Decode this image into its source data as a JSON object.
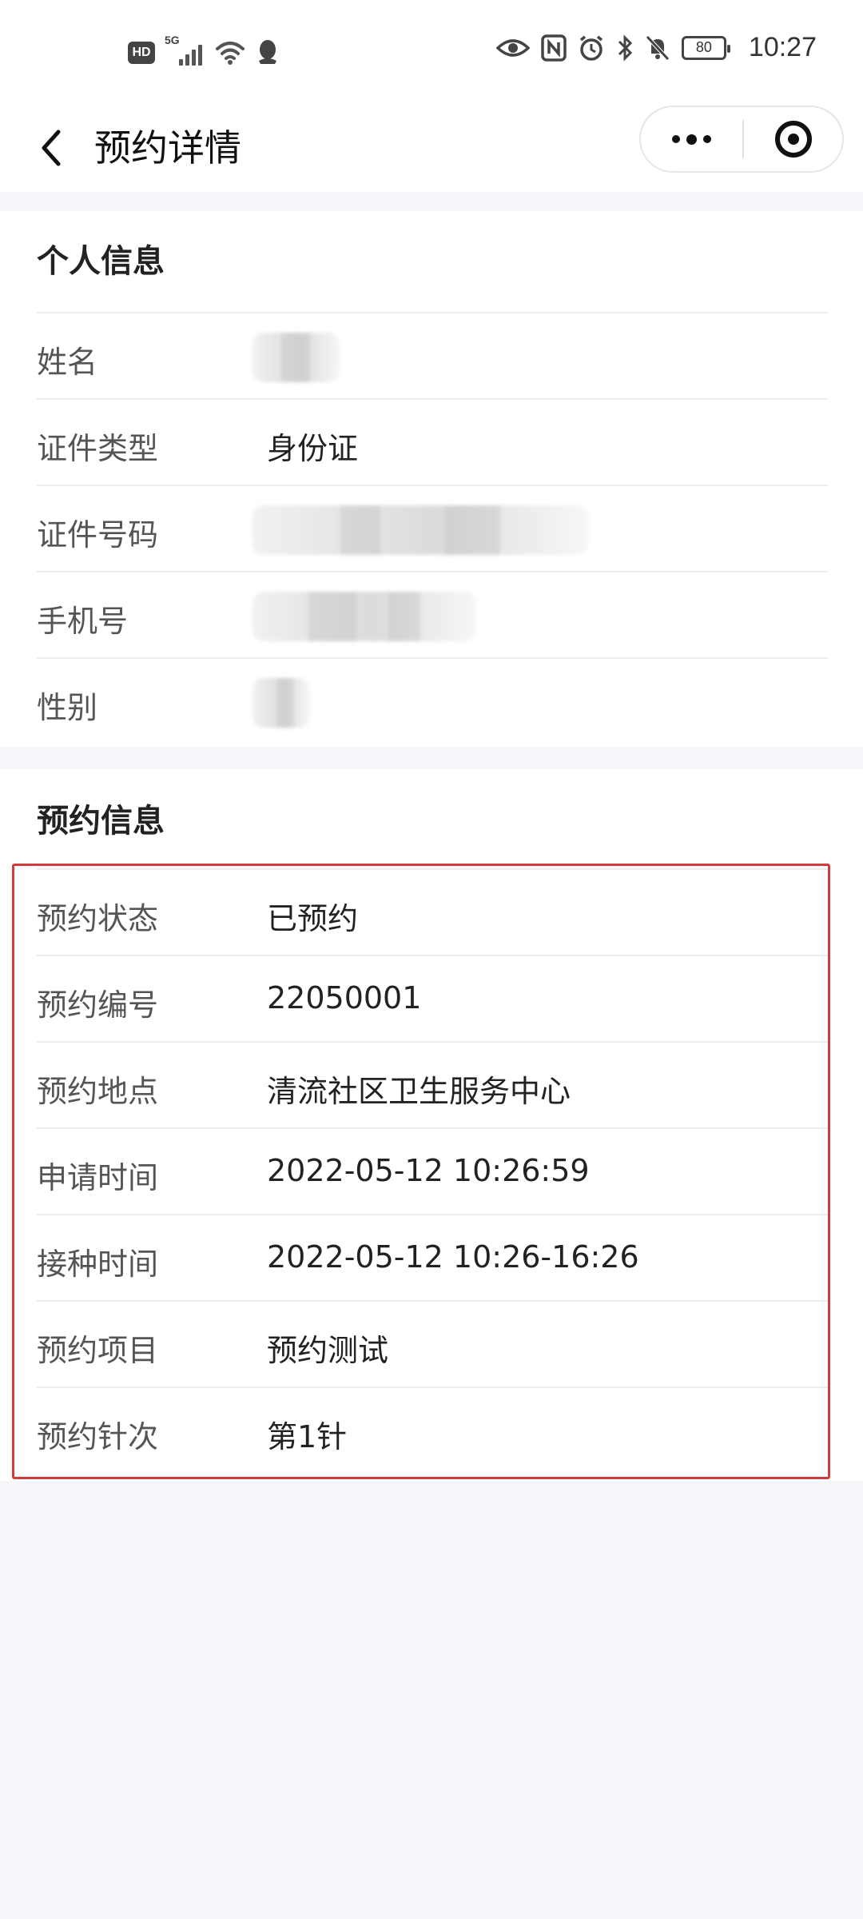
{
  "status_bar": {
    "hd": "HD",
    "network": "5G",
    "battery": "80",
    "time": "10:27"
  },
  "nav": {
    "title": "预约详情"
  },
  "personal_info": {
    "title": "个人信息",
    "rows": [
      {
        "label": "姓名",
        "value": null,
        "redacted": true
      },
      {
        "label": "证件类型",
        "value": "身份证",
        "redacted": false
      },
      {
        "label": "证件号码",
        "value": null,
        "redacted": true
      },
      {
        "label": "手机号",
        "value": null,
        "redacted": true
      },
      {
        "label": "性别",
        "value": null,
        "redacted": true
      }
    ]
  },
  "appointment_info": {
    "title": "预约信息",
    "rows": [
      {
        "label": "预约状态",
        "value": "已预约"
      },
      {
        "label": "预约编号",
        "value": "22050001"
      },
      {
        "label": "预约地点",
        "value": "清流社区卫生服务中心"
      },
      {
        "label": "申请时间",
        "value": "2022-05-12 10:26:59"
      },
      {
        "label": "接种时间",
        "value": "2022-05-12 10:26-16:26"
      },
      {
        "label": "预约项目",
        "value": "预约测试"
      },
      {
        "label": "预约针次",
        "value": "第1针"
      }
    ]
  },
  "colors": {
    "highlight_border": "#d23b3b",
    "page_background": "#f4f6f9"
  }
}
